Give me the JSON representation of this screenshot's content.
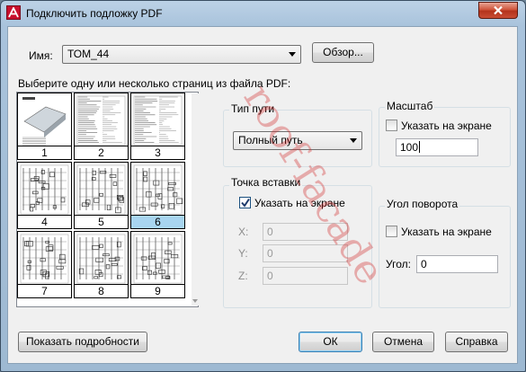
{
  "window": {
    "title": "Подключить подложку PDF",
    "app_icon_letter": "A",
    "close_icon": "close-icon"
  },
  "name_row": {
    "label": "Имя:",
    "value": "ТОМ_44",
    "browse_button": "Обзор..."
  },
  "pages": {
    "prompt": "Выберите одну или несколько страниц из файла PDF:",
    "items": [
      {
        "number": "1",
        "selected": false
      },
      {
        "number": "2",
        "selected": false
      },
      {
        "number": "3",
        "selected": false
      },
      {
        "number": "4",
        "selected": false
      },
      {
        "number": "5",
        "selected": false
      },
      {
        "number": "6",
        "selected": true
      },
      {
        "number": "7",
        "selected": false
      },
      {
        "number": "8",
        "selected": false
      },
      {
        "number": "9",
        "selected": false
      }
    ]
  },
  "path_type": {
    "label": "Тип пути",
    "selected": "Полный путь"
  },
  "insertion_point": {
    "label": "Точка вставки",
    "specify_on_screen": "Указать на экране",
    "specify_checked": true,
    "x_label": "X:",
    "x_value": "0",
    "y_label": "Y:",
    "y_value": "0",
    "z_label": "Z:",
    "z_value": "0"
  },
  "scale": {
    "label": "Масштаб",
    "specify_on_screen": "Указать на экране",
    "specify_checked": false,
    "value": "100"
  },
  "rotation": {
    "label": "Угол поворота",
    "specify_on_screen": "Указать на экране",
    "specify_checked": false,
    "angle_label": "Угол:",
    "angle_value": "0"
  },
  "footer": {
    "details_button": "Показать подробности",
    "ok_button": "ОК",
    "cancel_button": "Отмена",
    "help_button": "Справка"
  },
  "watermark": "roof-facade",
  "colors": {
    "selection": "#a8d5f0",
    "close_button": "#c94d35",
    "watermark": "#d22828"
  }
}
